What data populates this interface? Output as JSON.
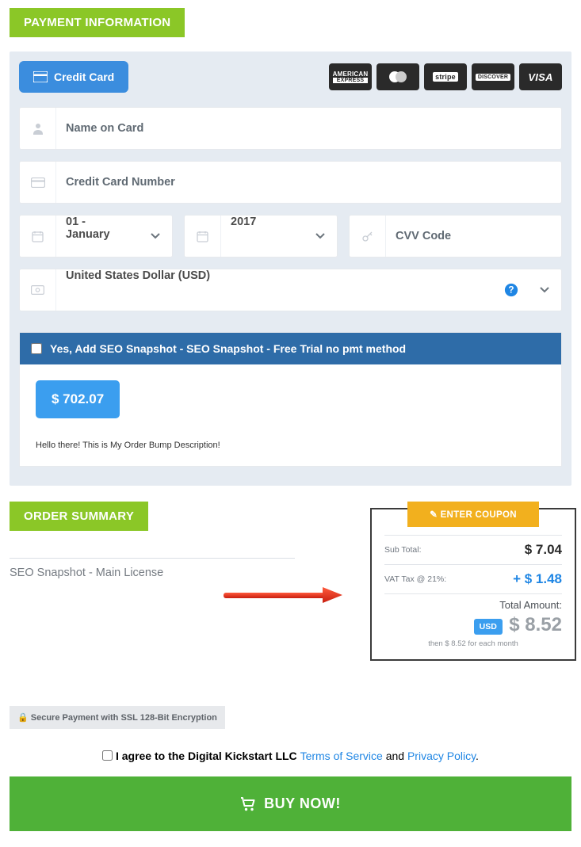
{
  "payment": {
    "section_title": "PAYMENT INFORMATION",
    "cc_button_label": "Credit Card",
    "brands": {
      "amex1": "AMERICAN",
      "amex2": "EXPRESS",
      "stripe": "stripe",
      "discover": "DISCOVER",
      "visa": "VISA"
    },
    "name_placeholder": "Name on Card",
    "number_placeholder": "Credit Card Number",
    "month_value": "01 - January",
    "year_value": "2017",
    "cvv_placeholder": "CVV Code",
    "currency_value": "United States Dollar (USD)"
  },
  "bump": {
    "label": "Yes, Add SEO Snapshot - SEO Snapshot - Free Trial no pmt method",
    "price": "$ 702.07",
    "description": "Hello there! This is My Order Bump Description!"
  },
  "summary": {
    "section_title": "ORDER SUMMARY",
    "item_name": "SEO Snapshot - Main License",
    "coupon_btn": "✎ ENTER COUPON",
    "subtotal_label": "Sub Total:",
    "subtotal_value": "$ 7.04",
    "vat_label": "VAT Tax @ 21%:",
    "vat_value": "+ $ 1.48",
    "total_label": "Total Amount:",
    "usd_chip": "USD",
    "total_value": "$ 8.52",
    "recurring": "then $ 8.52 for each month",
    "secure": "🔒 Secure Payment with SSL 128-Bit Encryption"
  },
  "agree": {
    "prefix": "I agree to the Digital Kickstart LLC ",
    "tos": "Terms of Service",
    "mid": " and ",
    "pp": "Privacy Policy",
    "suffix": "."
  },
  "buy": {
    "label": "BUY NOW!"
  }
}
